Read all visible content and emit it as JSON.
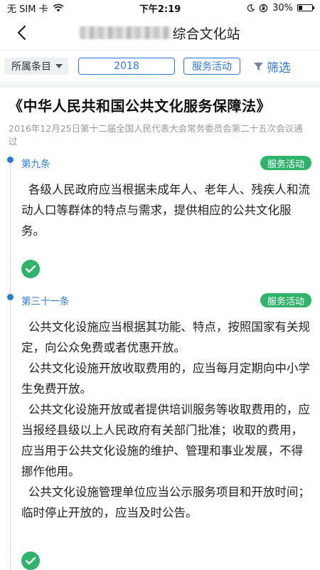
{
  "status_bar": {
    "carrier": "无 SIM 卡",
    "time": "下午2:19",
    "battery": "30%",
    "battery_level": 0.3
  },
  "header": {
    "title_suffix": "综合文化站"
  },
  "filters": {
    "category_label": "所属条目",
    "year": "2018",
    "type": "服务活动",
    "filter_label": "筛选"
  },
  "law": {
    "title": "《中华人民共和国公共文化服务保障法》",
    "subtitle": "2016年12月25日第十二届全国人民代表大会常务委员会第二十五次会议通过"
  },
  "articles": [
    {
      "number": "第九条",
      "tag": "服务活动",
      "paragraphs": [
        "各级人民政府应当根据未成年人、老年人、残疾人和流动人口等群体的特点与需求，提供相应的公共文化服务。"
      ]
    },
    {
      "number": "第三十一条",
      "tag": "服务活动",
      "paragraphs": [
        "公共文化设施应当根据其功能、特点，按照国家有关规定，向公众免费或者优惠开放。",
        "公共文化设施开放收取费用的，应当每月定期向中小学生免费开放。",
        "公共文化设施开放或者提供培训服务等收取费用的，应当报经县级以上人民政府有关部门批准；收取的费用，应当用于公共文化设施的维护、管理和事业发展，不得挪作他用。",
        "公共文化设施管理单位应当公示服务项目和开放时间；临时停止开放的，应当及时公告。"
      ]
    }
  ],
  "icons": {
    "back": "chevron-left-icon",
    "dropdown": "triangle-down-icon",
    "filter": "funnel-icon",
    "check": "check-circle-icon"
  },
  "colors": {
    "accent": "#2d7ad6",
    "tag_green": "#2fb36a"
  }
}
